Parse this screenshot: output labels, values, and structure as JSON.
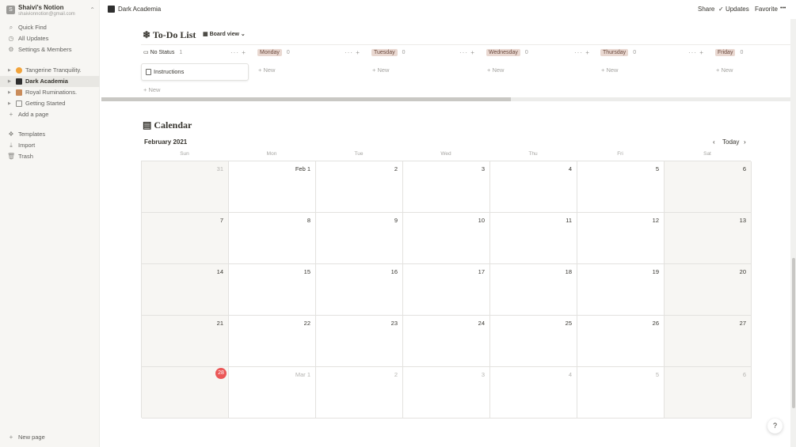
{
  "sidebar": {
    "workspace_initial": "S",
    "workspace_name": "Shaivi's Notion",
    "workspace_email": "shaivionnotion@gmail.com",
    "quick_find": "Quick Find",
    "all_updates": "All Updates",
    "settings": "Settings & Members",
    "pages": [
      {
        "label": "Tangerine Tranquility.",
        "icon": "orange-sun-icon"
      },
      {
        "label": "Dark Academia",
        "icon": "dark-academia-icon"
      },
      {
        "label": "Royal Ruminations.",
        "icon": "crown-icon"
      },
      {
        "label": "Getting Started",
        "icon": "page-icon"
      }
    ],
    "add_page": "Add a page",
    "templates": "Templates",
    "import": "Import",
    "trash": "Trash",
    "new_page": "New page"
  },
  "topbar": {
    "breadcrumb": "Dark Academia",
    "share": "Share",
    "updates": "Updates",
    "favorite": "Favorite",
    "more": "•••"
  },
  "board": {
    "title": "To-Do List",
    "view": "Board view",
    "columns": [
      {
        "label": "No Status",
        "count": "1"
      },
      {
        "label": "Monday",
        "count": "0"
      },
      {
        "label": "Tuesday",
        "count": "0"
      },
      {
        "label": "Wednesday",
        "count": "0"
      },
      {
        "label": "Thursday",
        "count": "0"
      },
      {
        "label": "Friday",
        "count": "0"
      }
    ],
    "card_title": "Instructions",
    "new_label": "+ New",
    "tools": "··· +"
  },
  "calendar": {
    "title": "Calendar",
    "month": "February 2021",
    "today": "Today",
    "prev": "‹",
    "next": "›",
    "weekdays": [
      "Sun",
      "Mon",
      "Tue",
      "Wed",
      "Thu",
      "Fri",
      "Sat"
    ],
    "days": [
      "31",
      "Feb 1",
      "2",
      "3",
      "4",
      "5",
      "6",
      "7",
      "8",
      "9",
      "10",
      "11",
      "12",
      "13",
      "14",
      "15",
      "16",
      "17",
      "18",
      "19",
      "20",
      "21",
      "22",
      "23",
      "24",
      "25",
      "26",
      "27",
      "28",
      "Mar 1",
      "2",
      "3",
      "4",
      "5",
      "6"
    ],
    "today_day": "28"
  },
  "help": "?"
}
